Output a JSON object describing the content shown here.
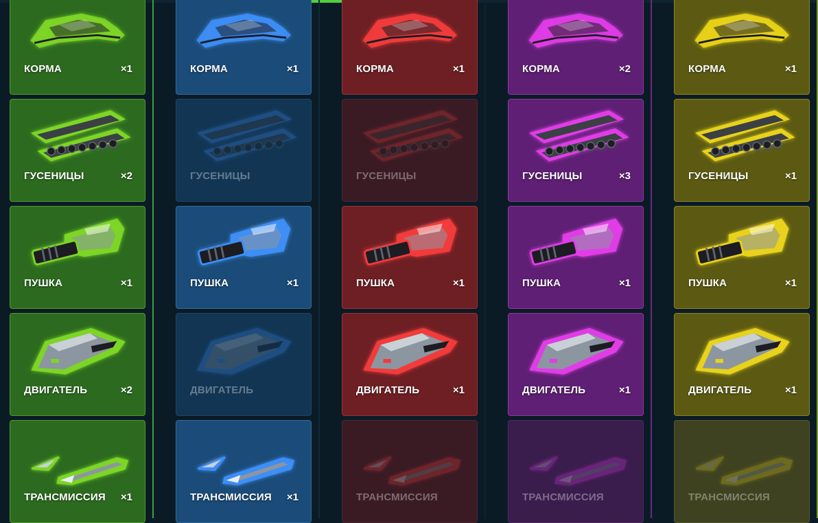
{
  "top_bar": {
    "active_color": "#4ed040"
  },
  "columns": [
    {
      "id": "green",
      "color": "#7dd526",
      "card_bg": "#2c6b1f",
      "card_border": "#4f9a2c",
      "locked_bg": "#2b4a22",
      "locked_border": "#3f5e2d",
      "strip": "#3aa23a",
      "items": [
        {
          "label": "КОРМА",
          "count": "×1",
          "icon": "hull-icon",
          "locked": false
        },
        {
          "label": "ГУСЕНИЦЫ",
          "count": "×2",
          "icon": "tracks-icon",
          "locked": false
        },
        {
          "label": "ПУШКА",
          "count": "×1",
          "icon": "cannon-icon",
          "locked": false
        },
        {
          "label": "ДВИГАТЕЛЬ",
          "count": "×2",
          "icon": "engine-icon",
          "locked": false
        },
        {
          "label": "ТРАНСМИССИЯ",
          "count": "×1",
          "icon": "transmission-icon",
          "locked": false
        }
      ]
    },
    {
      "id": "blue",
      "color": "#3d8ef5",
      "card_bg": "#1b4b78",
      "card_border": "#2d6aa3",
      "locked_bg": "#123554",
      "locked_border": "#1d4568",
      "strip": "#0f2a3c",
      "items": [
        {
          "label": "КОРМА",
          "count": "×1",
          "icon": "hull-icon",
          "locked": false
        },
        {
          "label": "ГУСЕНИЦЫ",
          "count": "",
          "icon": "tracks-icon",
          "locked": true
        },
        {
          "label": "ПУШКА",
          "count": "×1",
          "icon": "cannon-icon",
          "locked": false
        },
        {
          "label": "ДВИГАТЕЛЬ",
          "count": "",
          "icon": "engine-icon",
          "locked": true
        },
        {
          "label": "ТРАНСМИССИЯ",
          "count": "×1",
          "icon": "transmission-icon",
          "locked": false
        }
      ]
    },
    {
      "id": "red",
      "color": "#f23a3a",
      "card_bg": "#6e1f24",
      "card_border": "#9a3136",
      "locked_bg": "#3a1b24",
      "locked_border": "#4d2530",
      "strip": "#10222e",
      "items": [
        {
          "label": "КОРМА",
          "count": "×1",
          "icon": "hull-icon",
          "locked": false
        },
        {
          "label": "ГУСЕНИЦЫ",
          "count": "",
          "icon": "tracks-icon",
          "locked": true
        },
        {
          "label": "ПУШКА",
          "count": "×1",
          "icon": "cannon-icon",
          "locked": false
        },
        {
          "label": "ДВИГАТЕЛЬ",
          "count": "×1",
          "icon": "engine-icon",
          "locked": false
        },
        {
          "label": "ТРАНСМИССИЯ",
          "count": "",
          "icon": "transmission-icon",
          "locked": true
        }
      ]
    },
    {
      "id": "purple",
      "color": "#e03ce6",
      "card_bg": "#5e1f74",
      "card_border": "#8a3aa0",
      "locked_bg": "#3a1c4d",
      "locked_border": "#4d2a62",
      "strip": "#6a2a82",
      "items": [
        {
          "label": "КОРМА",
          "count": "×2",
          "icon": "hull-icon",
          "locked": false
        },
        {
          "label": "ГУСЕНИЦЫ",
          "count": "×3",
          "icon": "tracks-icon",
          "locked": false
        },
        {
          "label": "ПУШКА",
          "count": "×1",
          "icon": "cannon-icon",
          "locked": false
        },
        {
          "label": "ДВИГАТЕЛЬ",
          "count": "×1",
          "icon": "engine-icon",
          "locked": false
        },
        {
          "label": "ТРАНСМИССИЯ",
          "count": "",
          "icon": "transmission-icon",
          "locked": true
        }
      ]
    },
    {
      "id": "yellow",
      "color": "#e8d21a",
      "card_bg": "#5c5a12",
      "card_border": "#8a8526",
      "locked_bg": "#3e4220",
      "locked_border": "#54582c",
      "strip": "#7b9a2a",
      "items": [
        {
          "label": "КОРМА",
          "count": "×1",
          "icon": "hull-icon",
          "locked": false
        },
        {
          "label": "ГУСЕНИЦЫ",
          "count": "×1",
          "icon": "tracks-icon",
          "locked": false
        },
        {
          "label": "ПУШКА",
          "count": "×1",
          "icon": "cannon-icon",
          "locked": false
        },
        {
          "label": "ДВИГАТЕЛЬ",
          "count": "×1",
          "icon": "engine-icon",
          "locked": false
        },
        {
          "label": "ТРАНСМИССИЯ",
          "count": "",
          "icon": "transmission-icon",
          "locked": true
        }
      ]
    }
  ]
}
